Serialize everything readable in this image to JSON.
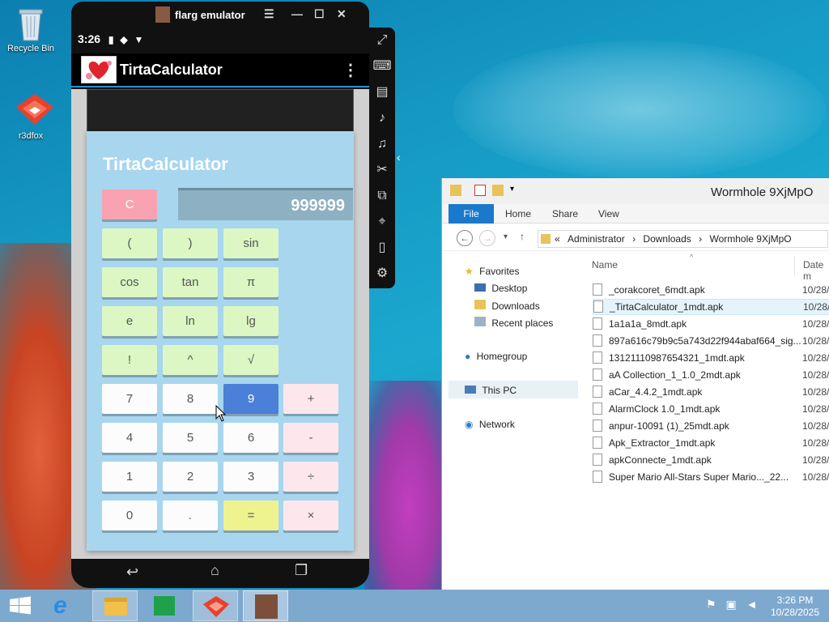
{
  "desktop": {
    "icons": [
      {
        "label": "Recycle Bin"
      },
      {
        "label": "r3dfox"
      }
    ]
  },
  "emulator": {
    "window_title": "flarg emulator",
    "status_time": "3:26",
    "app_name": "TirtaCalculator",
    "calc_title": "TirtaCalculator",
    "display_value": "999999",
    "keys": {
      "clear": "C",
      "lparen": "(",
      "rparen": ")",
      "sin": "sin",
      "cos": "cos",
      "tan": "tan",
      "pi": "π",
      "e": "e",
      "ln": "ln",
      "lg": "lg",
      "fact": "!",
      "pow": "^",
      "sqrt": "√",
      "k7": "7",
      "k8": "8",
      "k9": "9",
      "plus": "+",
      "k4": "4",
      "k5": "5",
      "k6": "6",
      "minus": "-",
      "k1": "1",
      "k2": "2",
      "k3": "3",
      "div": "÷",
      "k0": "0",
      "dot": ".",
      "eq": "=",
      "mul": "×"
    }
  },
  "explorer": {
    "title": "Wormhole 9XjMpO",
    "tabs": {
      "file": "File",
      "home": "Home",
      "share": "Share",
      "view": "View"
    },
    "breadcrumb": {
      "root": "Administrator",
      "mid": "Downloads",
      "leaf": "Wormhole 9XjMpO",
      "sep": "›",
      "overflow": "«"
    },
    "nav": {
      "favorites": "Favorites",
      "desktop": "Desktop",
      "downloads": "Downloads",
      "recent": "Recent places",
      "homegroup": "Homegroup",
      "thispc": "This PC",
      "network": "Network"
    },
    "columns": {
      "name": "Name",
      "date": "Date m"
    },
    "files": [
      {
        "name": "_corakcoret_6mdt.apk",
        "date": "10/28/"
      },
      {
        "name": "_TirtaCalculator_1mdt.apk",
        "date": "10/28/"
      },
      {
        "name": "1a1a1a_8mdt.apk",
        "date": "10/28/"
      },
      {
        "name": "897a616c79b9c5a743d22f944abaf664_sig...",
        "date": "10/28/"
      },
      {
        "name": "13121110987654321_1mdt.apk",
        "date": "10/28/"
      },
      {
        "name": "aA Collection_1_1.0_2mdt.apk",
        "date": "10/28/"
      },
      {
        "name": "aCar_4.4.2_1mdt.apk",
        "date": "10/28/"
      },
      {
        "name": "AlarmClock 1.0_1mdt.apk",
        "date": "10/28/"
      },
      {
        "name": "anpur-10091 (1)_25mdt.apk",
        "date": "10/28/"
      },
      {
        "name": "Apk_Extractor_1mdt.apk",
        "date": "10/28/"
      },
      {
        "name": "apkConnecte_1mdt.apk",
        "date": "10/28/"
      },
      {
        "name": "Super Mario All-Stars  Super Mario..._22...",
        "date": "10/28/"
      }
    ]
  },
  "taskbar": {
    "time": "3:26 PM",
    "date": "10/28/2025"
  }
}
